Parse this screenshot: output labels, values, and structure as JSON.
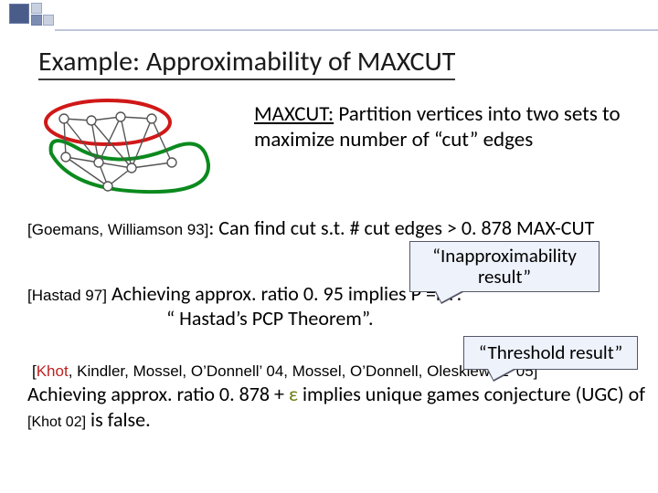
{
  "title": "Example: Approximability of MAXCUT",
  "definition": {
    "underlined": "MAXCUT:",
    "rest": " Partition  vertices into two sets to maximize number of “cut” edges"
  },
  "results": {
    "gw": {
      "cite": "[Goemans, Williamson 93]",
      "text": ": Can find cut s.t.  # cut edges > 0. 878 MAX-CUT"
    },
    "hastad": {
      "cite": "[Hastad 97]",
      "line1": " Achieving approx. ratio 0. 95 implies P =NP.",
      "line2": "“ Hastad’s PCP Theorem”."
    },
    "khot": {
      "cite_pre": "[",
      "cite_khot": "Khot",
      "cite_post": ", Kindler, Mossel, O’Donnell’ 04, Mossel, O’Donnell, Oleskiewicz’ 05]",
      "text_pre": "Achieving approx. ratio 0. 878 +",
      "eps": " ε ",
      "text_post": "implies unique games conjecture (UGC) of ",
      "cite_khot02": "[Khot 02]",
      "text_tail": " is false."
    }
  },
  "callouts": {
    "inapprox": "“Inapproximability result”",
    "threshold": "“Threshold result”"
  }
}
